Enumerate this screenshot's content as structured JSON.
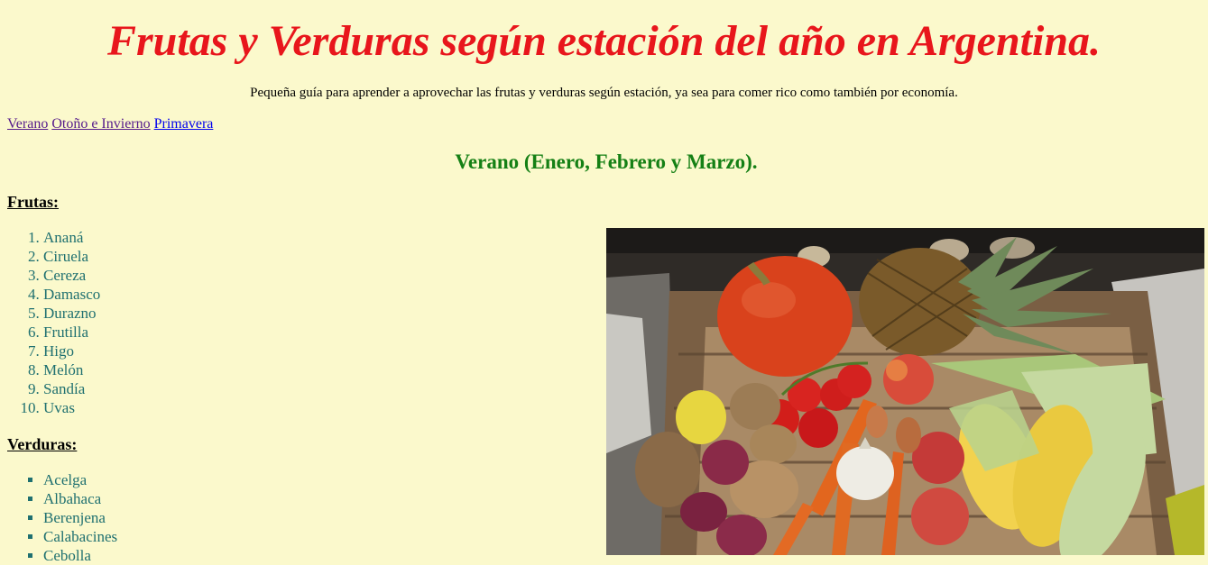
{
  "page": {
    "title": "Frutas y Verduras según estación del año en Argentina.",
    "subtitle": "Pequeña guía para aprender a aprovechar las frutas y verduras según estación, ya sea para comer rico como también por economía."
  },
  "nav": {
    "links": [
      "Verano",
      "Otoño e Invierno",
      "Primavera"
    ]
  },
  "season": {
    "heading": "Verano (Enero, Febrero y Marzo).",
    "fruits_heading": "Frutas:",
    "fruits": [
      "Ananá",
      "Ciruela",
      "Cereza",
      "Damasco",
      "Durazno",
      "Frutilla",
      "Higo",
      "Melón",
      "Sandía",
      "Uvas"
    ],
    "vegetables_heading": "Verduras:",
    "vegetables": [
      "Acelga",
      "Albahaca",
      "Berenjena",
      "Calabacines",
      "Cebolla"
    ]
  },
  "image": {
    "subject": "summer-produce-photo"
  },
  "colors": {
    "background": "#fbf9cc",
    "title": "#e8161c",
    "season_heading": "#158015",
    "list_text": "#1f7070"
  }
}
